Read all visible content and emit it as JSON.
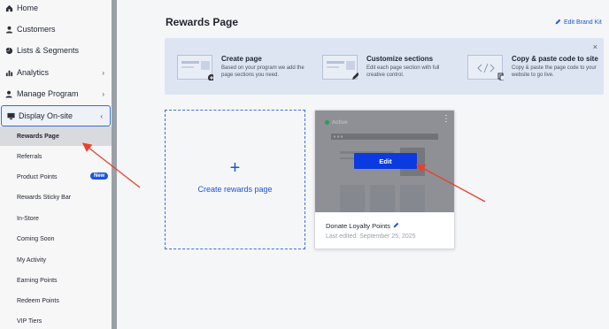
{
  "sidebar": {
    "items": [
      {
        "label": "Home",
        "icon": "home-icon"
      },
      {
        "label": "Customers",
        "icon": "users-icon"
      },
      {
        "label": "Lists & Segments",
        "icon": "pie-chart-icon"
      },
      {
        "label": "Analytics",
        "icon": "bar-chart-icon"
      },
      {
        "label": "Manage Program",
        "icon": "user-gear-icon"
      },
      {
        "label": "Display On-site",
        "icon": "monitor-icon"
      }
    ],
    "sub_items": [
      {
        "label": "Rewards Page"
      },
      {
        "label": "Referrals"
      },
      {
        "label": "Product Points"
      },
      {
        "label": "Rewards Sticky Bar"
      },
      {
        "label": "In-Store"
      },
      {
        "label": "Coming Soon"
      },
      {
        "label": "My Activity"
      },
      {
        "label": "Earning Points"
      },
      {
        "label": "Redeem Points"
      },
      {
        "label": "VIP Tiers"
      }
    ],
    "new_badge": "New"
  },
  "header": {
    "title": "Rewards Page",
    "edit_brand_kit": "Edit Brand Kit"
  },
  "info_bar": {
    "close": "×",
    "columns": [
      {
        "title": "Create page",
        "desc": "Based on your program we add the page sections you need."
      },
      {
        "title": "Customize sections",
        "desc": "Edit each page section with full creative control."
      },
      {
        "title": "Copy & paste code to site",
        "desc": "Copy & paste the page code to your website to go live."
      }
    ]
  },
  "create_card": {
    "plus": "+",
    "label": "Create rewards page"
  },
  "page_card": {
    "status": "Active",
    "edit_label": "Edit",
    "name": "Donate Loyalty Points",
    "last_edited": "Last edited: September 25, 2025"
  },
  "colors": {
    "accent": "#1a56db",
    "edit_button": "#0b3be0",
    "annotation_arrow": "#e8412c",
    "active_status": "#2e9e4f"
  }
}
